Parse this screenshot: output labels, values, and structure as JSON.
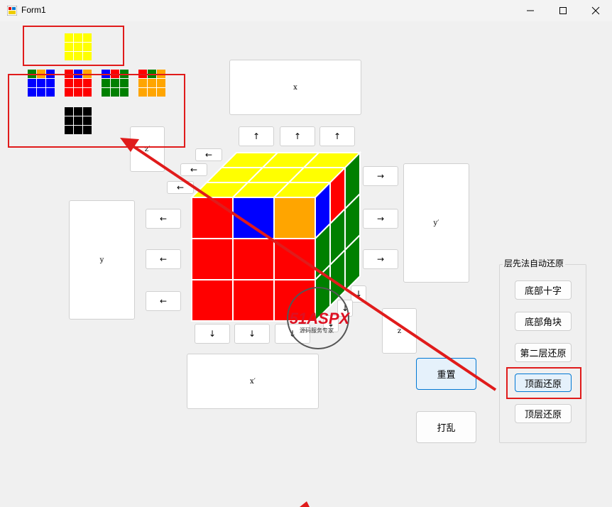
{
  "window": {
    "title": "Form1"
  },
  "colors": {
    "yellow": "#ffff00",
    "red": "#ff0000",
    "blue": "#0000ff",
    "green": "#008000",
    "orange": "#ffa500",
    "black": "#000000",
    "annotation": "#e01b1b"
  },
  "buttons": {
    "x": "x",
    "x_prime": "x′",
    "y": "y",
    "y_prime": "y′",
    "z": "z",
    "z_prime": "z′",
    "up": "↑",
    "down": "↓",
    "left": "←",
    "right": "→"
  },
  "panel": {
    "title": "层先法自动还原",
    "items": [
      "底部十字",
      "底部角块",
      "第二层还原",
      "顶面还原",
      "顶层还原"
    ]
  },
  "actions": {
    "reset": "重置",
    "scramble": "打乱"
  },
  "watermark": {
    "brand": "51ASPX",
    "slogan": "源码服务专家"
  },
  "net": {
    "top": [
      "yellow",
      "yellow",
      "yellow",
      "yellow",
      "yellow",
      "yellow",
      "yellow",
      "yellow",
      "yellow"
    ],
    "f1": [
      "green",
      "orange",
      "blue",
      "blue",
      "blue",
      "blue",
      "blue",
      "blue",
      "blue"
    ],
    "f2": [
      "red",
      "blue",
      "orange",
      "red",
      "red",
      "red",
      "red",
      "red",
      "red"
    ],
    "f3": [
      "blue",
      "red",
      "green",
      "green",
      "green",
      "green",
      "green",
      "green",
      "green"
    ],
    "f4": [
      "red",
      "green",
      "orange",
      "orange",
      "orange",
      "orange",
      "orange",
      "orange",
      "orange"
    ],
    "bottom": [
      "black",
      "black",
      "black",
      "black",
      "black",
      "black",
      "black",
      "black",
      "black"
    ]
  },
  "cube": {
    "front": [
      "red",
      "blue",
      "orange",
      "red",
      "red",
      "red",
      "red",
      "red",
      "red"
    ],
    "top": [
      "yellow",
      "yellow",
      "yellow",
      "yellow",
      "yellow",
      "yellow",
      "yellow",
      "yellow",
      "yellow"
    ],
    "right": [
      "blue",
      "red",
      "green",
      "green",
      "green",
      "green",
      "green",
      "green",
      "green"
    ]
  }
}
